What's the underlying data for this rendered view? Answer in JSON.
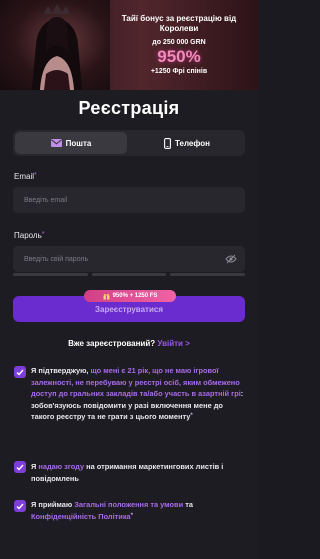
{
  "banner": {
    "title": "Тайї бонус за реєстрацію від Королеви",
    "amount": "до 250 000 GRN",
    "percent": "950%",
    "spins": "+1250 Фрі спінів"
  },
  "form": {
    "title": "Реєстрація",
    "tabs": [
      {
        "label": "Пошта",
        "icon": "mail-icon",
        "active": true
      },
      {
        "label": "Телефон",
        "icon": "phone-icon",
        "active": false
      }
    ],
    "email": {
      "label": "Email",
      "placeholder": "Введіть email"
    },
    "password": {
      "label": "Пароль",
      "placeholder": "Введіть свій пароль"
    },
    "promo_badge": "950% + 1250 FS",
    "submit_label": "Зареєструватися",
    "login_prompt": "Вже зареєстрований?",
    "login_link": "Увійти",
    "login_arrow": ">"
  },
  "agreements": {
    "age": {
      "pre": "Я підтверджую, ",
      "hl": "що мені є 21 рік, що не маю ігрової залежності, не перебуваю у реєстрі осіб, яким обмежено доступ до гральних закладів та/або участь в азартній грі",
      "post": ": зобов'язуюсь повідомити у разі включення мене до такого реєстру та не грати з цього моменту"
    },
    "marketing": {
      "pre": "Я ",
      "hl": "надаю згоду",
      "post": " на отримання маркетингових листів і повідомлень"
    },
    "terms": {
      "pre": "Я приймаю ",
      "hl1": "Загальні положення та умови",
      "mid": " та ",
      "hl2": "Конфіденційність Політика"
    }
  },
  "colors": {
    "accent": "#6b2ccf",
    "link": "#9a57ee",
    "badge": "#e0518f",
    "background": "#1d1c22"
  }
}
